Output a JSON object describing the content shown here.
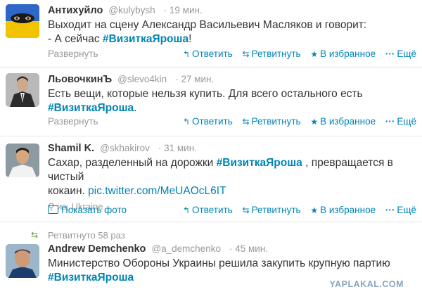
{
  "tweets": [
    {
      "name": "Антихуйло",
      "screen": "@kulybysh",
      "time": "19 мин.",
      "line1": "Выходит на сцену Александр Васильевич Масляков и говорит:",
      "line2_pre": "- А сейчас ",
      "hashtag": "#ВизиткаЯроша",
      "line2_post": "!",
      "expand": "Развернуть"
    },
    {
      "name": "ЛьовочкинЪ",
      "screen": "@slevo4kin",
      "time": "27 мин.",
      "line1": "Есть вещи, которые нельзя купить. Для всего остального есть",
      "hashtag": "#ВизиткаЯроша",
      "line2_post": ".",
      "expand": "Развернуть"
    },
    {
      "name": "Shamil K.",
      "screen": "@skhakirov",
      "time": "31 мин.",
      "line1_pre": "Сахар, разделенный на дорожки ",
      "hashtag": "#ВизиткаЯроша",
      "line1_post": " , превращается в чистый",
      "line2_pre": "кокаин. ",
      "link": "pic.twitter.com/MeUAOcL6IT",
      "place_prefix": "из:",
      "place": "Ukraine",
      "expand": "Показать фото"
    },
    {
      "retweeted": "Ретвитнуто 58 раз",
      "name": "Andrew Demchenko",
      "screen": "@a_demchenko",
      "time": "45 мин.",
      "line1": "Министерство Обороны Украины решила закупить крупную партию",
      "hashtag": "#ВизиткаЯроша"
    }
  ],
  "actions": {
    "reply": "Ответить",
    "retweet": "Ретвитнуть",
    "favorite": "В избранное",
    "more": "Ещё"
  },
  "watermark": "YAPLAKAL.COM",
  "colors": {
    "link": "#0084b4",
    "muted": "#999999",
    "text": "#333333",
    "retweet_green": "#5b9b3a"
  },
  "icons": [
    "reply-icon",
    "retweet-icon",
    "star-icon",
    "more-dots-icon",
    "location-pin-icon",
    "photo-icon",
    "retweet-indicator-icon"
  ]
}
